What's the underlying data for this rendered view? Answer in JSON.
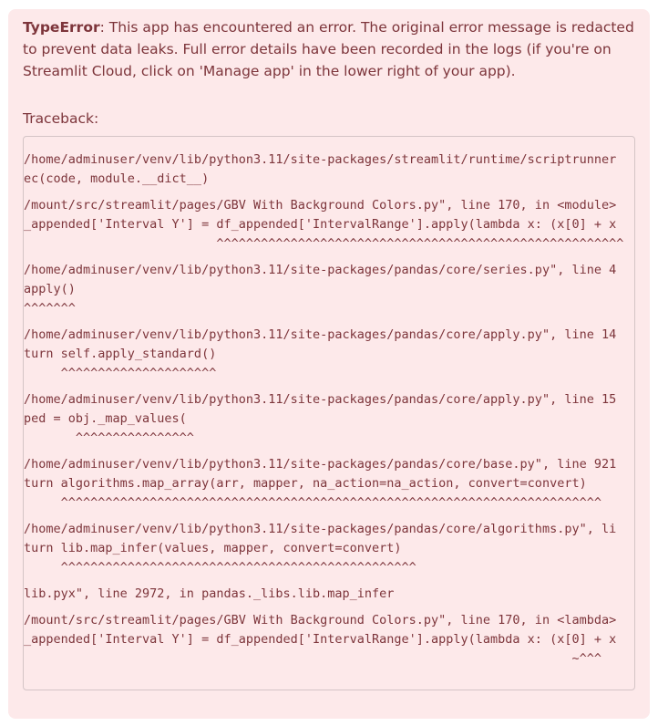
{
  "error": {
    "type": "TypeError",
    "message": ": This app has encountered an error. The original error message is redacted to prevent data leaks. Full error details have been recorded in the logs (if you're on Streamlit Cloud, click on 'Manage app' in the lower right of your app)."
  },
  "traceback_label": "Traceback:",
  "traceback_blocks": [
    [
      "/home/adminuser/venv/lib/python3.11/site-packages/streamlit/runtime/scriptrunner",
      "ec(code, module.__dict__)"
    ],
    [
      "/mount/src/streamlit/pages/GBV With Background Colors.py\", line 170, in <module>",
      "_appended['Interval Y'] = df_appended['IntervalRange'].apply(lambda x: (x[0] + x",
      "                          ^^^^^^^^^^^^^^^^^^^^^^^^^^^^^^^^^^^^^^^^^^^^^^^^^^^^^^^"
    ],
    [
      "/home/adminuser/venv/lib/python3.11/site-packages/pandas/core/series.py\", line 4",
      "apply()",
      "^^^^^^^"
    ],
    [
      "/home/adminuser/venv/lib/python3.11/site-packages/pandas/core/apply.py\", line 14",
      "turn self.apply_standard()",
      "     ^^^^^^^^^^^^^^^^^^^^^"
    ],
    [
      "/home/adminuser/venv/lib/python3.11/site-packages/pandas/core/apply.py\", line 15",
      "ped = obj._map_values(",
      "       ^^^^^^^^^^^^^^^^"
    ],
    [
      "/home/adminuser/venv/lib/python3.11/site-packages/pandas/core/base.py\", line 921",
      "turn algorithms.map_array(arr, mapper, na_action=na_action, convert=convert)",
      "     ^^^^^^^^^^^^^^^^^^^^^^^^^^^^^^^^^^^^^^^^^^^^^^^^^^^^^^^^^^^^^^^^^^^^^^^^^"
    ],
    [
      "/home/adminuser/venv/lib/python3.11/site-packages/pandas/core/algorithms.py\", li",
      "turn lib.map_infer(values, mapper, convert=convert)",
      "     ^^^^^^^^^^^^^^^^^^^^^^^^^^^^^^^^^^^^^^^^^^^^^^^^"
    ],
    [
      "lib.pyx\", line 2972, in pandas._libs.lib.map_infer"
    ],
    [
      "/mount/src/streamlit/pages/GBV With Background Colors.py\", line 170, in <lambda>",
      "_appended['Interval Y'] = df_appended['IntervalRange'].apply(lambda x: (x[0] + x",
      "                                                                          ~^^^"
    ]
  ],
  "colors": {
    "alert_bg": "#fde9ea",
    "alert_text": "#7d353b"
  }
}
